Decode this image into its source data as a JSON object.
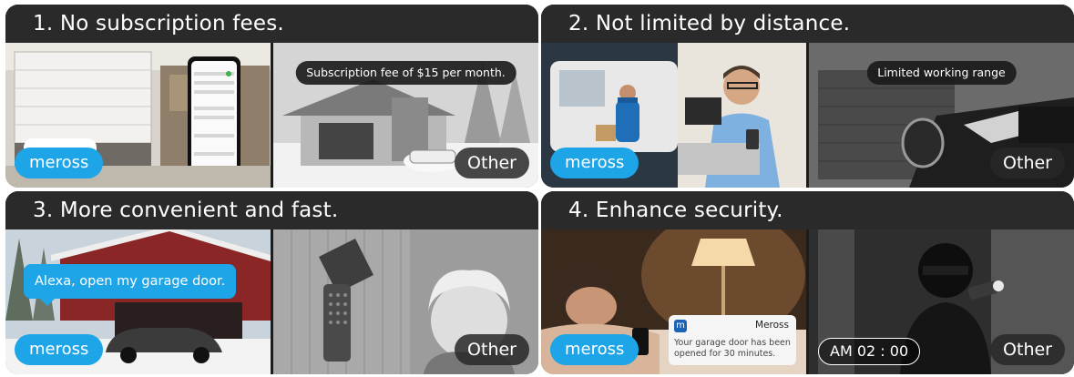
{
  "brand": "meross",
  "other": "Other",
  "panels": [
    {
      "title": "1. No subscription fees.",
      "caption": "Subscription fee of $15 per month."
    },
    {
      "title": "2. Not limited by distance.",
      "caption": "Limited working range"
    },
    {
      "title": "3. More convenient and fast.",
      "speech": "Alexa, open my garage door."
    },
    {
      "title": "4. Enhance security.",
      "notification": {
        "app": "Meross",
        "message": "Your garage door has been opened for 30 minutes."
      },
      "clock": "AM  02 : 00"
    }
  ],
  "colors": {
    "brand_blue": "#1da5e8",
    "title_bar": "#2a2a2a"
  }
}
